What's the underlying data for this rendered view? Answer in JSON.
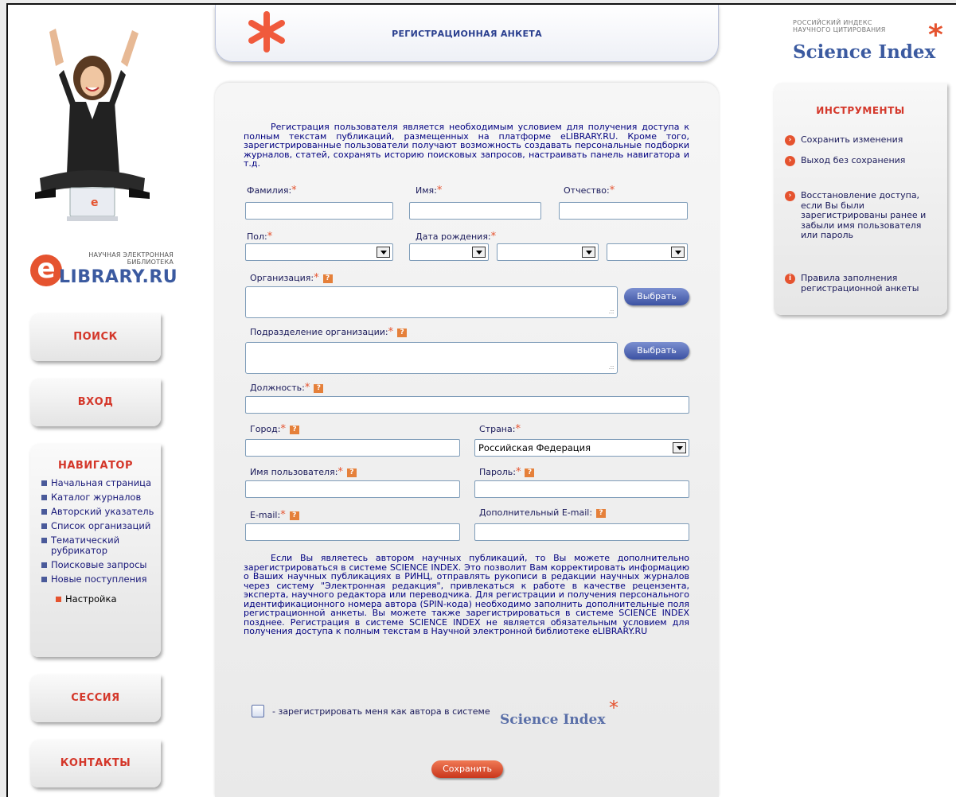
{
  "header": {
    "title": "РЕГИСТРАЦИОННАЯ АНКЕТА"
  },
  "elibrary_logo": {
    "small": "НАУЧНАЯ ЭЛЕКТРОННАЯ БИБЛИОТЕКА",
    "big": "LIBRARY.RU",
    "mark": "e"
  },
  "science_index_logo": {
    "small_line1": "РОССИЙСКИЙ ИНДЕКС",
    "small_line2": "НАУЧНОГО ЦИТИРОВАНИЯ",
    "big": "Science Index"
  },
  "left_nav": {
    "search": "ПОИСК",
    "login": "ВХОД",
    "navigator_title": "НАВИГАТОР",
    "navigator_items": [
      "Начальная страница",
      "Каталог журналов",
      "Авторский указатель",
      "Список организаций",
      "Тематический рубрикатор",
      "Поисковые запросы",
      "Новые поступления"
    ],
    "settings": "Настройка",
    "session": "СЕССИЯ",
    "contacts": "КОНТАКТЫ"
  },
  "form": {
    "intro": "Регистрация пользователя является необходимым условием для получения доступа к полным текстам публикаций, размещенных на платформе eLIBRARY.RU. Кроме того, зарегистрированные пользователи получают возможность создавать персональные подборки журналов, статей, сохранять историю поисковых запросов, настраивать панель навигатора и т.д.",
    "required_mark": "*",
    "help_mark": "?",
    "labels": {
      "last_name": "Фамилия:",
      "first_name": "Имя:",
      "middle_name": "Отчество:",
      "gender": "Пол:",
      "birth_date": "Дата рождения:",
      "organization": "Организация:",
      "department": "Подразделение организации:",
      "position": "Должность:",
      "city": "Город:",
      "country": "Страна:",
      "username": "Имя пользователя:",
      "password": "Пароль:",
      "email": "E-mail:",
      "extra_email": "Дополнительный E-mail:"
    },
    "country_value": "Российская Федерация",
    "pick_button": "Выбрать",
    "author_text": "Если Вы являетесь автором научных публикаций, то Вы можете дополнительно зарегистрироваться в системе SCIENCE INDEX. Это позволит Вам корректировать информацию о Ваших научных публикациях в РИНЦ, отправлять рукописи в редакции научных журналов через систему \"Электронная редакция\", привлекаться к работе в качестве рецензента, эксперта, научного редактора или переводчика. Для регистрации и получения персонального идентификационного номера автора (SPIN-кода) необходимо заполнить дополнительные поля регистрационной анкеты. Вы можете также зарегистрироваться в системе SCIENCE INDEX позднее. Регистрация в системе SCIENCE INDEX не является обязательным условием для получения доступа к полным текстам в Научной электронной библиотеке eLIBRARY.RU",
    "author_checkbox_label": "- зарегистрировать меня как автора в системе",
    "author_checkbox_logo": "Science Index",
    "save_button": "Сохранить"
  },
  "tools": {
    "title": "ИНСТРУМЕНТЫ",
    "items": [
      "Сохранить изменения",
      "Выход без сохранения",
      "Восстановление доступа, если Вы были зарегистрированы ранее и забыли имя пользователя или пароль",
      "Правила заполнения регистрационной анкеты"
    ],
    "bullet": "›",
    "info_bullet": "i"
  },
  "colors": {
    "accent": "#e5532f",
    "brand_blue": "#3b5aa0",
    "nav_title": "#d4372a"
  }
}
